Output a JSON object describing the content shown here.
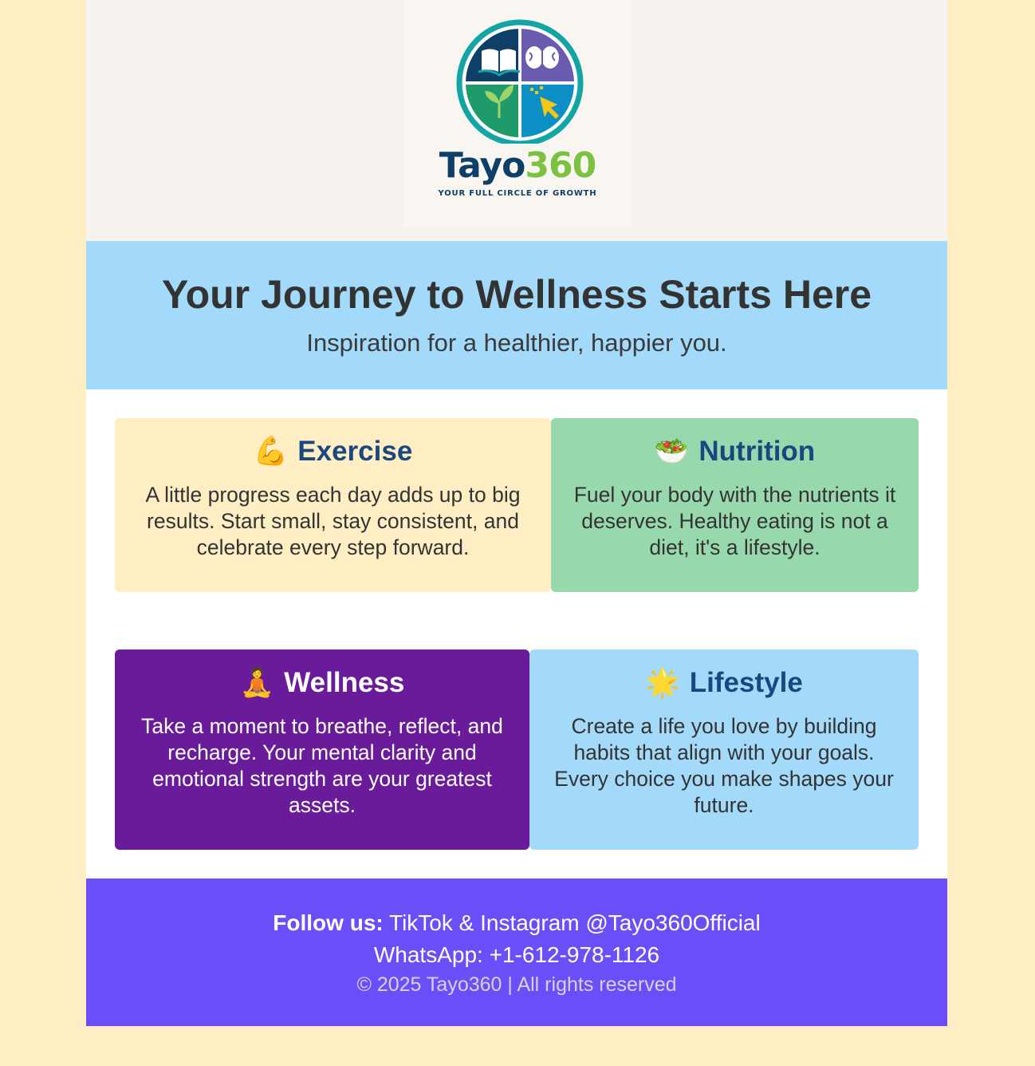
{
  "brand": {
    "name_part1": "Tayo",
    "name_part2": "360",
    "tagline": "YOUR FULL CIRCLE OF GROWTH"
  },
  "hero": {
    "title": "Your Journey to Wellness Starts Here",
    "subtitle": "Inspiration for a healthier, happier you."
  },
  "cards": [
    {
      "emoji": "💪",
      "title": "Exercise",
      "text": "A little progress each day adds up to big results. Start small, stay consistent, and celebrate every step forward.",
      "bg": "#ffeec4"
    },
    {
      "emoji": "🥗",
      "title": "Nutrition",
      "text": "Fuel your body with the nutrients it deserves. Healthy eating is not a diet, it's a lifestyle.",
      "bg": "#98d8ad"
    },
    {
      "emoji": "🧘",
      "title": "Wellness",
      "text": "Take a moment to breathe, reflect, and recharge. Your mental clarity and emotional strength are your greatest assets.",
      "bg": "#6a1b9a"
    },
    {
      "emoji": "🌟",
      "title": "Lifestyle",
      "text": "Create a life you love by building habits that align with your goals. Every choice you make shapes your future.",
      "bg": "#a3daf9"
    }
  ],
  "footer": {
    "follow_label": "Follow us:",
    "follow_text": "TikTok & Instagram @Tayo360Official",
    "whatsapp": "WhatsApp: +1-612-978-1126",
    "copyright": "© 2025 Tayo360 | All rights reserved",
    "bg": "#6c4ef8"
  },
  "colors": {
    "page_bg": "#ffeec4",
    "hero_bg": "#a3daf9",
    "heading_blue": "#1a4780",
    "logo_teal": "#13a5a5",
    "logo_navy": "#0e3f66",
    "logo_green": "#7cc242"
  },
  "icons": [
    "open-book-icon",
    "brain-icon",
    "sprout-icon",
    "cursor-click-icon"
  ]
}
